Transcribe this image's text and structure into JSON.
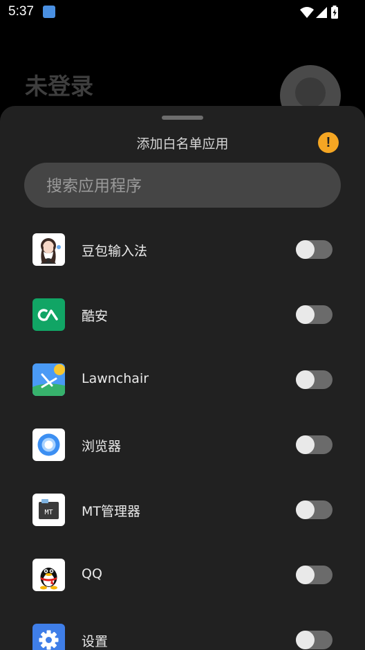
{
  "status_bar": {
    "time": "5:37"
  },
  "background": {
    "title": "未登录"
  },
  "sheet": {
    "title": "添加白名单应用",
    "info_icon_text": "!",
    "info_color": "#f5a623"
  },
  "search": {
    "placeholder": "搜索应用程序",
    "value": ""
  },
  "apps": [
    {
      "name": "豆包输入法",
      "icon": "doubao-ime-icon",
      "enabled": false
    },
    {
      "name": "酷安",
      "icon": "coolapk-icon",
      "enabled": false
    },
    {
      "name": "Lawnchair",
      "icon": "lawnchair-icon",
      "enabled": false
    },
    {
      "name": "浏览器",
      "icon": "browser-icon",
      "enabled": false
    },
    {
      "name": "MT管理器",
      "icon": "mt-manager-icon",
      "enabled": false,
      "icon_text": "MT"
    },
    {
      "name": "QQ",
      "icon": "qq-icon",
      "enabled": false
    },
    {
      "name": "设置",
      "icon": "settings-icon",
      "enabled": false
    }
  ]
}
